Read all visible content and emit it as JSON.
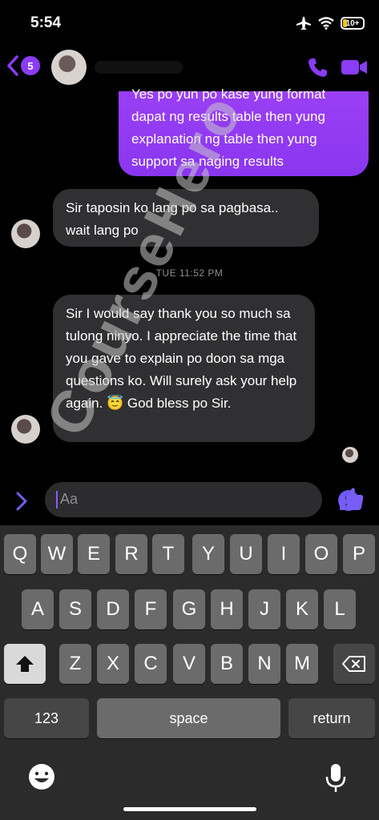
{
  "status": {
    "time": "5:54",
    "battery": "10+"
  },
  "header": {
    "unread_count": "5"
  },
  "messages": [
    {
      "sender": "me",
      "text": "Yes po yun po kase yung format dapat ng results table then yung explanation ng table then yung support sa naging results"
    },
    {
      "sender": "them",
      "text": "Sir taposin ko lang po sa pagbasa.. wait lang po"
    },
    {
      "sender": "them",
      "text": "Sir I would say thank you so much sa tulong ninyo. I appreciate the time that you gave to explain po doon sa mga questions ko. Will surely ask your help again. 😇 God bless po Sir."
    }
  ],
  "timestamp": "TUE 11:52 PM",
  "composer": {
    "placeholder": "Aa"
  },
  "keyboard": {
    "row1": [
      "Q",
      "W",
      "E",
      "R",
      "T",
      "Y",
      "U",
      "I",
      "O",
      "P"
    ],
    "row2": [
      "A",
      "S",
      "D",
      "F",
      "G",
      "H",
      "J",
      "K",
      "L"
    ],
    "row3": [
      "Z",
      "X",
      "C",
      "V",
      "B",
      "N",
      "M"
    ],
    "numbers_label": "123",
    "space_label": "space",
    "return_label": "return"
  },
  "watermark": "CourseHero",
  "colors": {
    "accent": "#8a3cf7",
    "bubble_in": "#303032",
    "keyboard_bg": "#2b2b2b"
  }
}
